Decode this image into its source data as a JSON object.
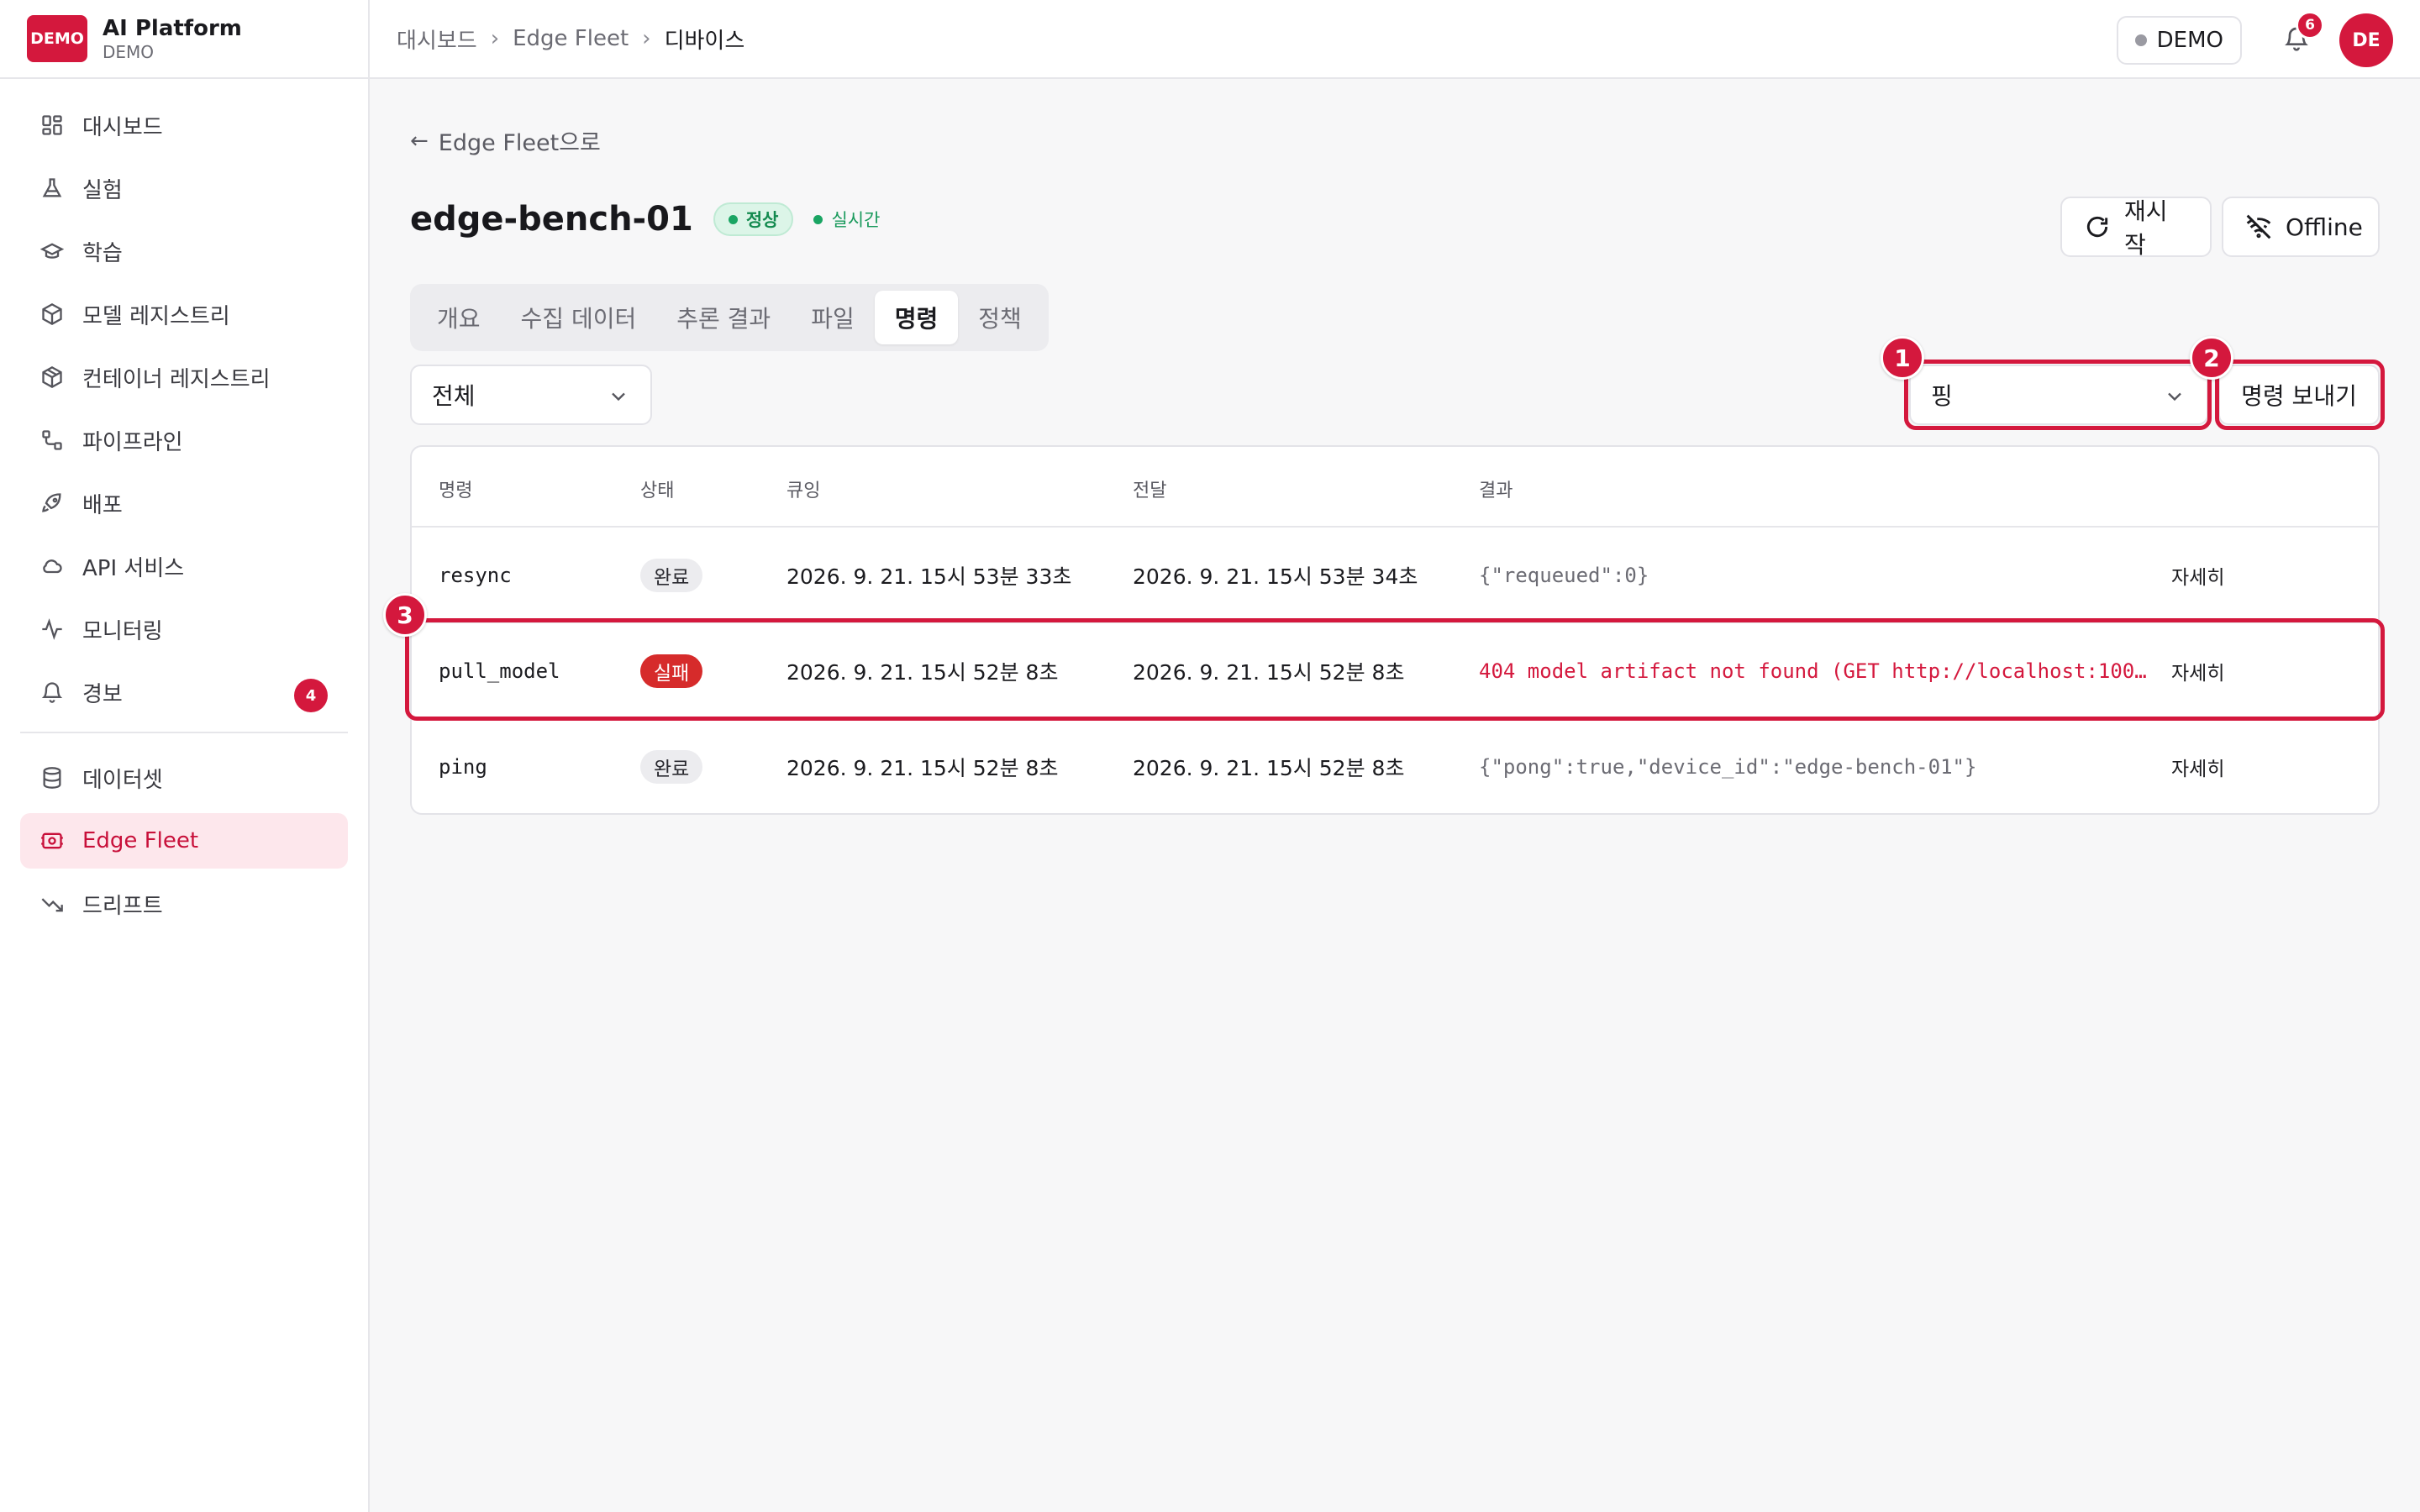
{
  "brand": {
    "logo_text": "DEMO",
    "name": "AI Platform",
    "sub": "DEMO"
  },
  "sidebar": {
    "items": [
      {
        "label": "대시보드",
        "icon": "dashboard-icon"
      },
      {
        "label": "실험",
        "icon": "flask-icon"
      },
      {
        "label": "학습",
        "icon": "graduation-cap-icon"
      },
      {
        "label": "모델 레지스트리",
        "icon": "cube-icon"
      },
      {
        "label": "컨테이너 레지스트리",
        "icon": "container-icon"
      },
      {
        "label": "파이프라인",
        "icon": "pipeline-icon"
      },
      {
        "label": "배포",
        "icon": "rocket-icon"
      },
      {
        "label": "API 서비스",
        "icon": "cloud-icon"
      },
      {
        "label": "모니터링",
        "icon": "activity-icon"
      },
      {
        "label": "경보",
        "icon": "bell-icon",
        "badge": "4"
      }
    ],
    "items2": [
      {
        "label": "데이터셋",
        "icon": "database-icon"
      },
      {
        "label": "Edge Fleet",
        "icon": "edge-device-icon",
        "active": true
      },
      {
        "label": "드리프트",
        "icon": "trending-down-icon"
      }
    ]
  },
  "breadcrumb": {
    "items": [
      "대시보드",
      "Edge Fleet"
    ],
    "current": "디바이스"
  },
  "topbar": {
    "env_label": "DEMO",
    "notifications_count": "6",
    "avatar_initials": "DE"
  },
  "page": {
    "back_label": "Edge Fleet으로",
    "device_name": "edge-bench-01",
    "status_label": "정상",
    "live_label": "실시간",
    "restart_label": "재시작",
    "offline_label": "Offline"
  },
  "tabs": [
    {
      "label": "개요",
      "active": false
    },
    {
      "label": "수집 데이터",
      "active": false
    },
    {
      "label": "추론 결과",
      "active": false
    },
    {
      "label": "파일",
      "active": false
    },
    {
      "label": "명령",
      "active": true
    },
    {
      "label": "정책",
      "active": false
    }
  ],
  "filter": {
    "selected": "전체"
  },
  "command_select": {
    "selected": "핑"
  },
  "send_button": {
    "label": "명령 보내기"
  },
  "markers": [
    "1",
    "2",
    "3"
  ],
  "table": {
    "columns": [
      "명령",
      "상태",
      "큐잉",
      "전달",
      "결과"
    ],
    "rows": [
      {
        "command": "resync",
        "status": "완료",
        "status_kind": "ok",
        "queued": "2026. 9. 21. 15시 53분 33초",
        "delivered": "2026. 9. 21. 15시 53분 34초",
        "result": "{\"requeued\":0}",
        "error": false,
        "detail": "자세히"
      },
      {
        "command": "pull_model",
        "status": "실패",
        "status_kind": "fail",
        "queued": "2026. 9. 21. 15시 52분 8초",
        "delivered": "2026. 9. 21. 15시 52분 8초",
        "result": "404 model artifact not found (GET http://localhost:100…",
        "error": true,
        "detail": "자세히"
      },
      {
        "command": "ping",
        "status": "완료",
        "status_kind": "ok",
        "queued": "2026. 9. 21. 15시 52분 8초",
        "delivered": "2026. 9. 21. 15시 52분 8초",
        "result": "{\"pong\":true,\"device_id\":\"edge-bench-01\"}",
        "error": false,
        "detail": "자세히"
      }
    ]
  },
  "colors": {
    "accent": "#d4183d",
    "success": "#1aa563",
    "danger": "#d62b2b"
  }
}
